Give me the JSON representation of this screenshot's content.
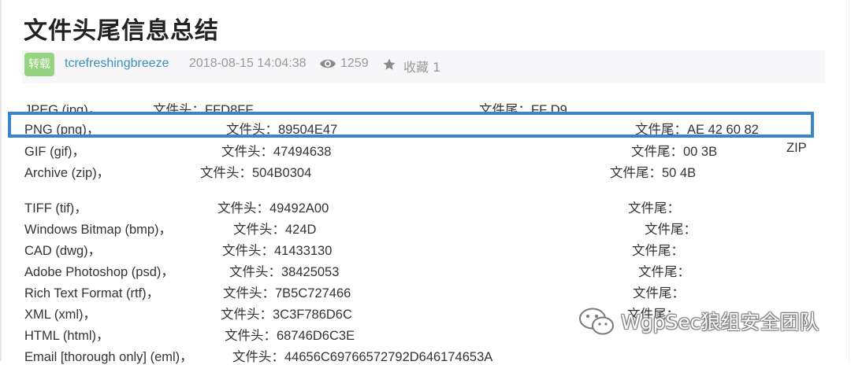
{
  "article": {
    "title": "文件头尾信息总结",
    "badge": "转载",
    "author": "tcrefreshingbreeze",
    "date": "2018-08-15 14:04:38",
    "views": "1259",
    "favorites": "收藏 1"
  },
  "rows": [
    {
      "name": "JPEG (jpg)，",
      "head": "文件头：FFD8FF",
      "tail": "文件尾：FF D9",
      "extra": ""
    },
    {
      "name": "PNG (png)，",
      "head": "文件头：89504E47",
      "tail": "文件尾：AE 42 60 82",
      "extra": ""
    },
    {
      "name": "GIF (gif)，",
      "head": "文件头：47494638",
      "tail": "文件尾：00 3B",
      "extra": "ZIP"
    },
    {
      "name": "Archive (zip)，",
      "head": "文件头：504B0304",
      "tail": "文件尾：50 4B",
      "extra": ""
    },
    {
      "name": "TIFF (tif)，",
      "head": "文件头：49492A00",
      "tail": "文件尾：",
      "extra": ""
    },
    {
      "name": "Windows Bitmap (bmp)，",
      "head": "文件头：424D",
      "tail": "文件尾：",
      "extra": ""
    },
    {
      "name": "CAD (dwg)，",
      "head": "文件头：41433130",
      "tail": "文件尾：",
      "extra": ""
    },
    {
      "name": "Adobe Photoshop (psd)，",
      "head": "文件头：38425053",
      "tail": "文件尾：",
      "extra": ""
    },
    {
      "name": "Rich Text Format (rtf)，",
      "head": "文件头：7B5C727466",
      "tail": "文件尾：",
      "extra": ""
    },
    {
      "name": "XML (xml)，",
      "head": "文件头：3C3F786D6C",
      "tail": "文件尾：",
      "extra": ""
    },
    {
      "name": "HTML (html)，",
      "head": "文件头：68746D6C3E",
      "tail": "",
      "extra": ""
    },
    {
      "name": "Email [thorough only] (eml)，",
      "head": "文件头：44656C69766572792D646174653A",
      "tail": "",
      "extra": ""
    }
  ],
  "watermark": {
    "icon": "wechat-icon",
    "text": "WgpSec狼组安全团队"
  },
  "colors": {
    "highlight_border": "#3a85c9",
    "badge_bg": "#96d47f",
    "author_link": "#3a8fb8",
    "meta_bg": "#f7f7f9"
  }
}
